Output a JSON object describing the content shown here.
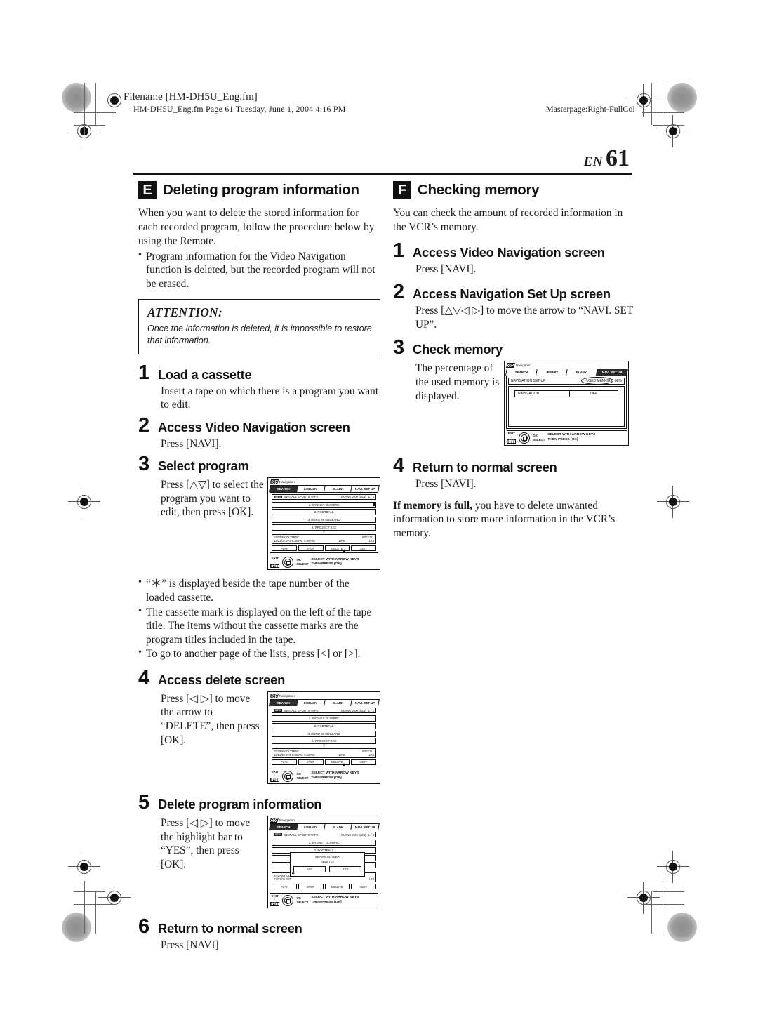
{
  "header": {
    "filename": "Filename [HM-DH5U_Eng.fm]",
    "subline": "HM-DH5U_Eng.fm  Page 61  Tuesday, June 1, 2004  4:16 PM",
    "masterpage": "Masterpage:Right-FullCol"
  },
  "page": {
    "lang": "EN",
    "number": "61"
  },
  "left": {
    "badge": "E",
    "title": "Deleting program information",
    "intro": "When you want to delete the stored information for each recorded program, follow the procedure below by using the Remote.",
    "intro_bullets": [
      "Program information for the Video Navigation function is deleted, but the recorded program will not be erased."
    ],
    "attention": {
      "title": "ATTENTION:",
      "body": "Once the information is deleted, it is impossible to restore that information."
    },
    "steps": [
      {
        "num": "1",
        "title": "Load a cassette",
        "body": "Insert a tape on which there is a program you want to edit."
      },
      {
        "num": "2",
        "title": "Access Video Navigation screen",
        "body": "Press [NAVI]."
      },
      {
        "num": "3",
        "title": "Select program",
        "body": "Press [△▽] to select the program you want to edit, then press [OK]."
      },
      {
        "num": "4",
        "title": "Access delete screen",
        "body": "Press [◁ ▷] to move the arrow to “DELETE”, then press [OK]."
      },
      {
        "num": "5",
        "title": "Delete program information",
        "body": "Press [◁ ▷] to move the highlight bar to “YES”, then press [OK]."
      },
      {
        "num": "6",
        "title": "Return to normal screen",
        "body": "Press [NAVI]"
      }
    ],
    "note_bullets": [
      "“＊” is displayed beside the tape number of the loaded cassette.",
      "The cassette mark is displayed on the left of the tape title. The items without the cassette marks are the program titles included in the tape.",
      "To go to another page of the lists, press [<] or [>]."
    ]
  },
  "right": {
    "badge": "F",
    "title": "Checking memory",
    "intro": "You can check the amount of recorded information in the VCR’s memory.",
    "steps": [
      {
        "num": "1",
        "title": "Access Video Navigation screen",
        "body": "Press [NAVI]."
      },
      {
        "num": "2",
        "title": "Access Navigation Set Up screen",
        "body": "Press [△▽◁ ▷] to move the arrow to “NAVI. SET UP”."
      },
      {
        "num": "3",
        "title": "Check memory",
        "body": "The percentage of the used memory is displayed."
      },
      {
        "num": "4",
        "title": "Return to normal screen",
        "body": "Press [NAVI]."
      }
    ],
    "footnote_lead": "If memory is full,",
    "footnote_rest": " you have to delete unwanted information to store more information in the VCR’s memory."
  },
  "osd": {
    "navigation_label": "Navigation",
    "tabs": [
      "SEARCH",
      "LIBRARY",
      "BLANK",
      "NAVI. SET UP"
    ],
    "cassette_badge": "STD",
    "tape_title": "0107 ALL SPORTS TAPE",
    "blank_info": "BLANK 2:00 (LS3)",
    "page_indicator": "1 / 2",
    "programs": [
      "1. SYDNEY OLYMPIC",
      "2. FOOTBALL",
      "3. EURO 96 ENGLAND",
      "4. PROJECT XYZ"
    ],
    "detail": {
      "title": "SYDNEY OLYMPIC",
      "date": "12/21/02 SAT",
      "start": "6:30 AM",
      "end": "5:50 PM",
      "link": "LINK",
      "special": "SPECIAL",
      "speed": "LS3"
    },
    "buttons": [
      "PLAY",
      "STOP",
      "DELETE",
      "EDIT"
    ],
    "exit_label": "EXIT",
    "exit_key": "NAVI",
    "ok_label": "OK",
    "select_label": "SELECT",
    "hint_line1": "SELECT WITH ARROW KEYS",
    "hint_line2": "THEN PRESS [OK]"
  },
  "osd_delete_dialog": {
    "line1": "PROGRAM INFO",
    "line2": "DELETE?",
    "no": "NO",
    "yes": "YES"
  },
  "osd_setup": {
    "navigation_label": "Navigation",
    "tabs": [
      "SEARCH",
      "LIBRARY",
      "BLANK",
      "NAVI. SET UP"
    ],
    "title": "NAVIGATION SET UP",
    "used_memory_label": "USED MEMORY",
    "used_memory_value": "88%",
    "item_label": "NAVIGATION",
    "item_value": "OFF",
    "exit_label": "EXIT",
    "exit_key": "NAVI",
    "ok_label": "OK",
    "select_label": "SELECT",
    "hint_line1": "SELECT WITH ARROW KEYS",
    "hint_line2": "THEN PRESS [OK]"
  }
}
